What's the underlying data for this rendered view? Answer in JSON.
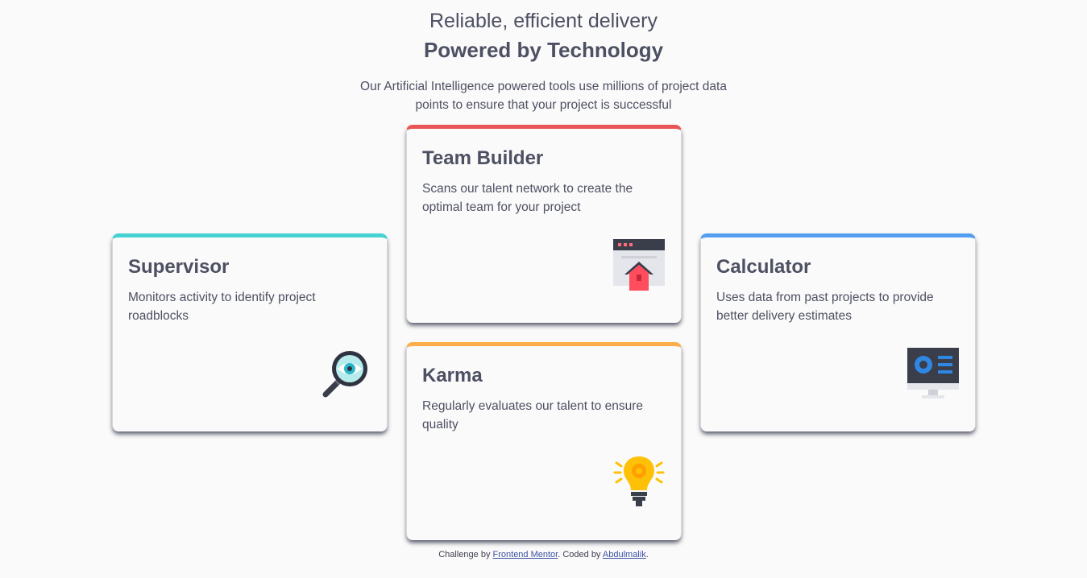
{
  "colors": {
    "cyan": "#44d3d2",
    "red": "#ea5454",
    "orange": "#fcae4a",
    "blue": "#549ef2",
    "text": "#4d5062"
  },
  "header": {
    "eyebrow": "Reliable, efficient delivery",
    "headline": "Powered by Technology",
    "intro": "Our Artificial Intelligence powered tools use millions of project data points to ensure that your project is successful"
  },
  "cards": {
    "supervisor": {
      "title": "Supervisor",
      "description": "Monitors activity to identify project roadblocks",
      "icon": "magnifier-eye-icon"
    },
    "team_builder": {
      "title": "Team Builder",
      "description": "Scans our talent network to create the optimal team for your project",
      "icon": "browser-home-icon"
    },
    "karma": {
      "title": "Karma",
      "description": "Regularly evaluates our talent to ensure quality",
      "icon": "lightbulb-gear-icon"
    },
    "calculator": {
      "title": "Calculator",
      "description": "Uses data from past projects to provide better delivery estimates",
      "icon": "monitor-chart-icon"
    }
  },
  "footer": {
    "prefix": "Challenge by ",
    "link1": "Frontend Mentor",
    "middle": ". Coded by ",
    "link2": "Abdulmalik",
    "suffix": "."
  }
}
